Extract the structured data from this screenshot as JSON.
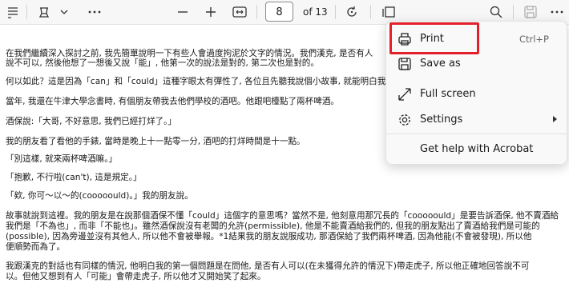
{
  "toolbar": {
    "page_number": "8",
    "page_total": "of 13",
    "icons": [
      "draw-icon",
      "chevron-down-icon",
      "more-icon",
      "zoom-out-icon",
      "zoom-in-icon",
      "fit-page-icon",
      "rotate-icon",
      "page-view-icon",
      "search-icon",
      "save-icon",
      "more-options-icon"
    ]
  },
  "document": {
    "paragraphs": [
      "在我們繼續深入探討之前, 我先簡單說明一下有些人會過度拘泥於文字的情況。我們漢克, 是否有人",
      "說不可以, 然後他想了一想後又說「能」, 他第一次的說法是對的, 第二次也是對的。",
      "何以如此？這是因為「can」和「could」這種字眼太有彈性了, 各位且先聽我說個小故事, 就能明白我想",
      "當年, 我還在牛津大學念書時, 有個朋友帶我去他們學校的酒吧。他跟吧檯點了兩杯啤酒。",
      "酒保說:「大哥, 不好意思, 我們已經打烊了。」",
      "我的朋友看了看他的手錶, 當時是晚上十一點零一分, 酒吧的打烊時間是十一點。",
      "「別這樣, 就來兩杯啤酒嘛。」",
      "「抱歉, 不行啦(can't), 這是規定。」",
      "「欸, 你可～以～的(cooooould)。」我的朋友說。",
      "故事就說到這裡。我的朋友是在說那個酒保不懂「could」這個字的意思嗎？當然不是, 他刻意用那冗長的「cooooould」是要告訴酒保, 他不賣酒給",
      "我們是「不為也」, 而非「不能也」。雖然酒保說沒有老闆的允許(permissible), 他是不能賣酒給我們的, 但我的朋友點出了賣酒給我們是可能的",
      "(possible), 因為旁邊並沒有其他人, 所以他不會被舉報。*1結果我的朋友說服成功, 那酒保給了我們兩杯啤酒, 因為他能(不會被發現), 所以他",
      "便順勢而為了。",
      "我跟漢克的對話也有同樣的情況, 他明白我的第一個問題是在問他, 是否有人可以(在未獲得允許的情況下)帶走虎子, 所以他正確地回答說不可",
      "以。但他又想到有人「可能」會帶走虎子, 所以他才又開始笑了起來。"
    ]
  },
  "menu": {
    "items": [
      {
        "label": "Print",
        "shortcut": "Ctrl+P",
        "icon": "printer-icon"
      },
      {
        "label": "Save as",
        "shortcut": "",
        "icon": "save-as-icon"
      },
      {
        "label": "Full screen",
        "shortcut": "",
        "icon": "full-screen-icon"
      },
      {
        "label": "Settings",
        "shortcut": "",
        "icon": "gear-icon"
      },
      {
        "label": "Get help with Acrobat",
        "shortcut": "",
        "icon": ""
      }
    ]
  },
  "colors": {
    "highlight": "#e3202a",
    "toolbar_bg": "#f7f7f7",
    "menu_bg": "#f9f9f9"
  }
}
